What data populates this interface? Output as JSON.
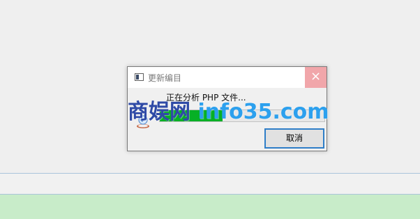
{
  "dialog": {
    "title": "更新编目",
    "close_icon": "×",
    "message": "正在分析 PHP 文件...",
    "progress": 0.38,
    "cancel_label": "取消"
  },
  "watermark": {
    "site_name": "商娱网",
    "domain": "info35.com"
  },
  "colors": {
    "progress_fill": "#06b025",
    "close_button_bg": "#f1a6aa",
    "cancel_border": "#2f7ec8",
    "bottom_panel": "#c8ecc9",
    "watermark_blue": "#2f4aa6",
    "watermark_light_blue": "#2ca0ee"
  }
}
